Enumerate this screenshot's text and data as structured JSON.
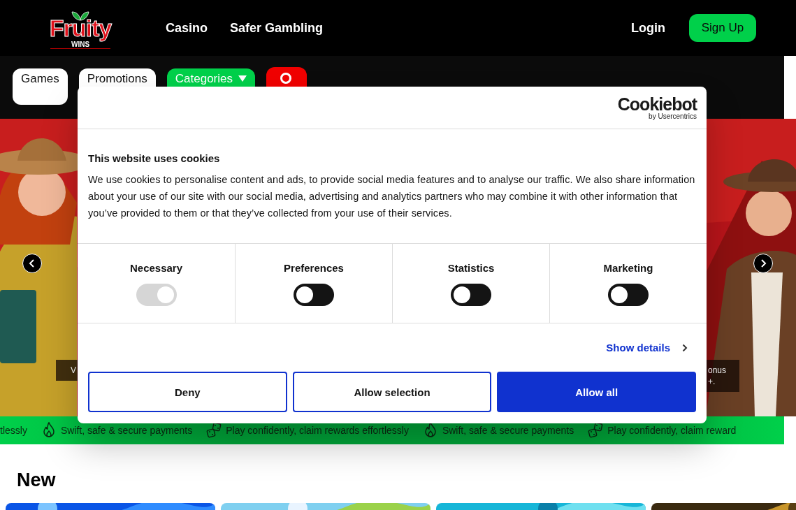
{
  "header": {
    "logo": {
      "word": "Fruity",
      "tagline": "WINS"
    },
    "nav": [
      "Casino",
      "Safer Gambling"
    ],
    "login": "Login",
    "signup": "Sign Up"
  },
  "toolbar": {
    "items": [
      {
        "kind": "tab",
        "label": "Games"
      },
      {
        "kind": "tab",
        "label": "Promotions"
      },
      {
        "kind": "dropdown",
        "label": "Categories"
      }
    ]
  },
  "banner": {
    "left_caption": [
      "V"
    ],
    "right_caption": [
      "onus",
      "+."
    ]
  },
  "ticker": [
    {
      "kind": "plain",
      "text": "tlessly"
    },
    {
      "kind": "fire",
      "text": "Swift, safe & secure payments"
    },
    {
      "kind": "dice",
      "text": "Play confidently, claim rewards effortlessly"
    },
    {
      "kind": "fire",
      "text": "Swift, safe & secure payments"
    },
    {
      "kind": "dice",
      "text": "Play confidently, claim reward"
    }
  ],
  "section": {
    "title": "New"
  },
  "consent": {
    "brand": "Cookiebot",
    "brand_sub": "by Usercentrics",
    "title": "This website uses cookies",
    "text": "We use cookies to personalise content and ads, to provide social media features and to analyse our traffic. We also share information about your use of our site with our social media, advertising and analytics partners who may combine it with other information that you’ve provided to them or that they’ve collected from your use of their services.",
    "categories": [
      {
        "label": "Necessary",
        "checked": true,
        "disabled": true
      },
      {
        "label": "Preferences",
        "checked": false,
        "disabled": false
      },
      {
        "label": "Statistics",
        "checked": false,
        "disabled": false
      },
      {
        "label": "Marketing",
        "checked": false,
        "disabled": false
      }
    ],
    "details_link": "Show details",
    "buttons": [
      {
        "label": "Deny",
        "kind": "outline"
      },
      {
        "label": "Allow selection",
        "kind": "outline"
      },
      {
        "label": "Allow all",
        "kind": "filled"
      }
    ]
  }
}
